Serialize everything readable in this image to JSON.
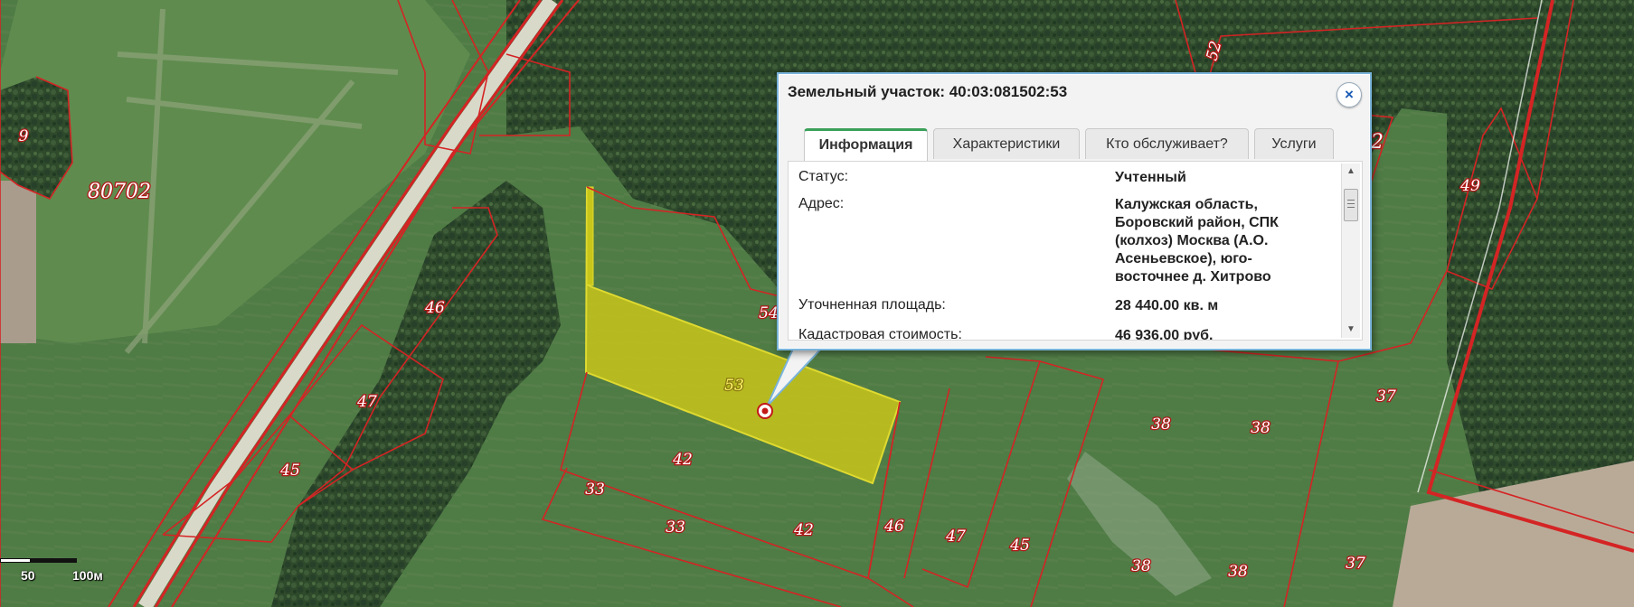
{
  "popup": {
    "title": "Земельный участок: 40:03:081502:53",
    "close_symbol": "×",
    "tabs": [
      {
        "label": "Информация",
        "active": true
      },
      {
        "label": "Характеристики",
        "active": false
      },
      {
        "label": "Кто обслуживает?",
        "active": false
      },
      {
        "label": "Услуги",
        "active": false
      }
    ],
    "info": [
      {
        "label": "Статус:",
        "value": "Учтенный"
      },
      {
        "label": "Адрес:",
        "value": "Калужская область, Боровский район, СПК (колхоз) Москва (А.О. Асеньевское), юго-восточнее д. Хитрово"
      },
      {
        "label": "Уточненная площадь:",
        "value": "28 440.00 кв. м"
      },
      {
        "label": "Кадастровая стоимость:",
        "value": "46 936.00 руб."
      }
    ]
  },
  "map": {
    "selected_parcel": "53",
    "parcel_labels": [
      "9",
      "80702",
      "46",
      "47",
      "45",
      "54",
      "53",
      "42",
      "33",
      "33",
      "42",
      "46",
      "47",
      "45",
      "38",
      "38",
      "37",
      "37",
      "38",
      "38",
      "52",
      "2",
      "49"
    ],
    "colors": {
      "boundary": "#d42424",
      "selected_fill": "#c8c61a",
      "forest": "#2f4a2c",
      "field": "#4f7a45"
    }
  },
  "scale": {
    "label_a": "50",
    "label_b": "100м"
  },
  "icons": {
    "marker": "location-marker-icon",
    "close": "close-icon",
    "scroll_up": "arrow-up-icon",
    "scroll_down": "arrow-down-icon"
  }
}
